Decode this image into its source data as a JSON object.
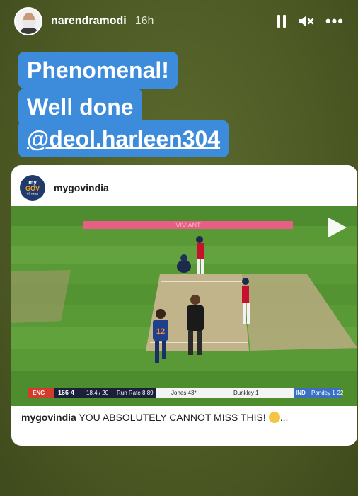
{
  "header": {
    "username": "narendramodi",
    "time": "16h"
  },
  "story_text": {
    "line1": "Phenomenal!",
    "line2": "Well done",
    "line3": "@deol.harleen304"
  },
  "post": {
    "account": "mygovindia",
    "logo_text": "my GOV",
    "caption_user": "mygovindia",
    "caption_text": "YOU ABSOLUTELY CANNOT MISS THIS!",
    "caption_suffix": "..."
  },
  "scoreboard": {
    "team": "ENG",
    "score": "166-4",
    "overs": "18.4 / 20",
    "run_rate": "Run Rate 8.89",
    "batter1": "Jones 43*",
    "batter2": "Dunkley 1",
    "bowling_team": "IND",
    "bowler": "Pandey 1-22"
  },
  "player_number": "12",
  "colors": {
    "caption_bg": "#3d8cdc",
    "story_bg": "#4e5a26",
    "pitch_green": "#5f9d3a"
  },
  "icons": [
    "pause-icon",
    "mute-icon",
    "more-icon",
    "play-icon"
  ]
}
